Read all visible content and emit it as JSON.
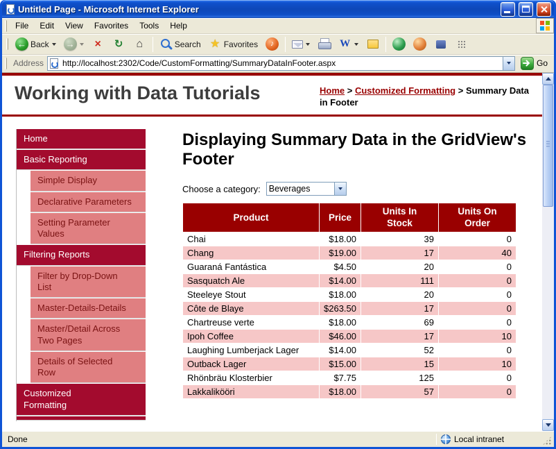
{
  "window": {
    "title": "Untitled Page - Microsoft Internet Explorer",
    "statusbar": {
      "status": "Done",
      "zone": "Local intranet"
    }
  },
  "menubar": {
    "items": [
      "File",
      "Edit",
      "View",
      "Favorites",
      "Tools",
      "Help"
    ]
  },
  "toolbar": {
    "icon_glyphs": {
      "back": "←",
      "forward": "→",
      "stop": "×",
      "refresh": "↻",
      "home": "⌂",
      "favorites": "★",
      "media": "♪",
      "edit": "W"
    },
    "buttons": [
      {
        "name": "back-button",
        "icon": "back",
        "label": "Back",
        "dropdown": true
      },
      {
        "name": "forward-button",
        "icon": "forward",
        "dropdown": true,
        "disabled": true
      },
      {
        "name": "stop-button",
        "icon": "stop"
      },
      {
        "name": "refresh-button",
        "icon": "refresh"
      },
      {
        "name": "home-button",
        "icon": "home"
      },
      {
        "sep": true
      },
      {
        "name": "search-button",
        "icon": "search",
        "label": "Search"
      },
      {
        "name": "favorites-button",
        "icon": "favorites",
        "label": "Favorites"
      },
      {
        "name": "media-button",
        "icon": "media"
      },
      {
        "sep": true
      },
      {
        "name": "mail-button",
        "icon": "mail",
        "dropdown": true
      },
      {
        "name": "print-button",
        "icon": "print"
      },
      {
        "name": "edit-button",
        "icon": "edit",
        "dropdown": true
      },
      {
        "name": "discuss-button",
        "icon": "discuss"
      },
      {
        "sep": true
      },
      {
        "name": "messenger-button",
        "icon": "globe2"
      },
      {
        "name": "contacts-button",
        "icon": "person"
      },
      {
        "name": "research-button",
        "icon": "book"
      },
      {
        "name": "links-button",
        "icon": "grid"
      }
    ]
  },
  "addressbar": {
    "label": "Address",
    "url": "http://localhost:2302/Code/CustomFormatting/SummaryDataInFooter.aspx",
    "go_label": "Go"
  },
  "masthead": {
    "title": "Working with Data Tutorials",
    "breadcrumb": {
      "links": [
        "Home",
        "Customized Formatting"
      ],
      "separator": ">",
      "current": "Summary Data in Footer"
    }
  },
  "sidebar": {
    "items": [
      {
        "label": "Home",
        "type": "section"
      },
      {
        "label": "Basic Reporting",
        "type": "section"
      },
      {
        "label": "Simple Display",
        "type": "sub"
      },
      {
        "label": "Declarative Parameters",
        "type": "sub"
      },
      {
        "label": "Setting Parameter Values",
        "type": "sub"
      },
      {
        "label": "Filtering Reports",
        "type": "section"
      },
      {
        "label": "Filter by Drop-Down List",
        "type": "sub"
      },
      {
        "label": "Master-Details-Details",
        "type": "sub"
      },
      {
        "label": "Master/Detail Across Two Pages",
        "type": "sub"
      },
      {
        "label": "Details of Selected Row",
        "type": "sub"
      },
      {
        "label": "Customized Formatting",
        "type": "section"
      }
    ]
  },
  "content": {
    "heading": "Displaying Summary Data in the GridView's Footer",
    "category_label": "Choose a category:",
    "category_selected": "Beverages"
  },
  "grid": {
    "headers": [
      "Product",
      "Price",
      "Units In Stock",
      "Units On Order"
    ],
    "rows": [
      [
        "Chai",
        "$18.00",
        "39",
        "0"
      ],
      [
        "Chang",
        "$19.00",
        "17",
        "40"
      ],
      [
        "Guaraná Fantástica",
        "$4.50",
        "20",
        "0"
      ],
      [
        "Sasquatch Ale",
        "$14.00",
        "111",
        "0"
      ],
      [
        "Steeleye Stout",
        "$18.00",
        "20",
        "0"
      ],
      [
        "Côte de Blaye",
        "$263.50",
        "17",
        "0"
      ],
      [
        "Chartreuse verte",
        "$18.00",
        "69",
        "0"
      ],
      [
        "Ipoh Coffee",
        "$46.00",
        "17",
        "10"
      ],
      [
        "Laughing Lumberjack Lager",
        "$14.00",
        "52",
        "0"
      ],
      [
        "Outback Lager",
        "$15.00",
        "15",
        "10"
      ],
      [
        "Rhönbräu Klosterbier",
        "$7.75",
        "125",
        "0"
      ],
      [
        "Lakkalikööri",
        "$18.00",
        "57",
        "0"
      ]
    ]
  },
  "colors": {
    "accent": "#990000",
    "nav_section": "#a30b2e",
    "nav_sub": "#e07f81",
    "nav_sub_text": "#7a1313",
    "row_pink": "#f6c7c7",
    "link": "#990000"
  }
}
